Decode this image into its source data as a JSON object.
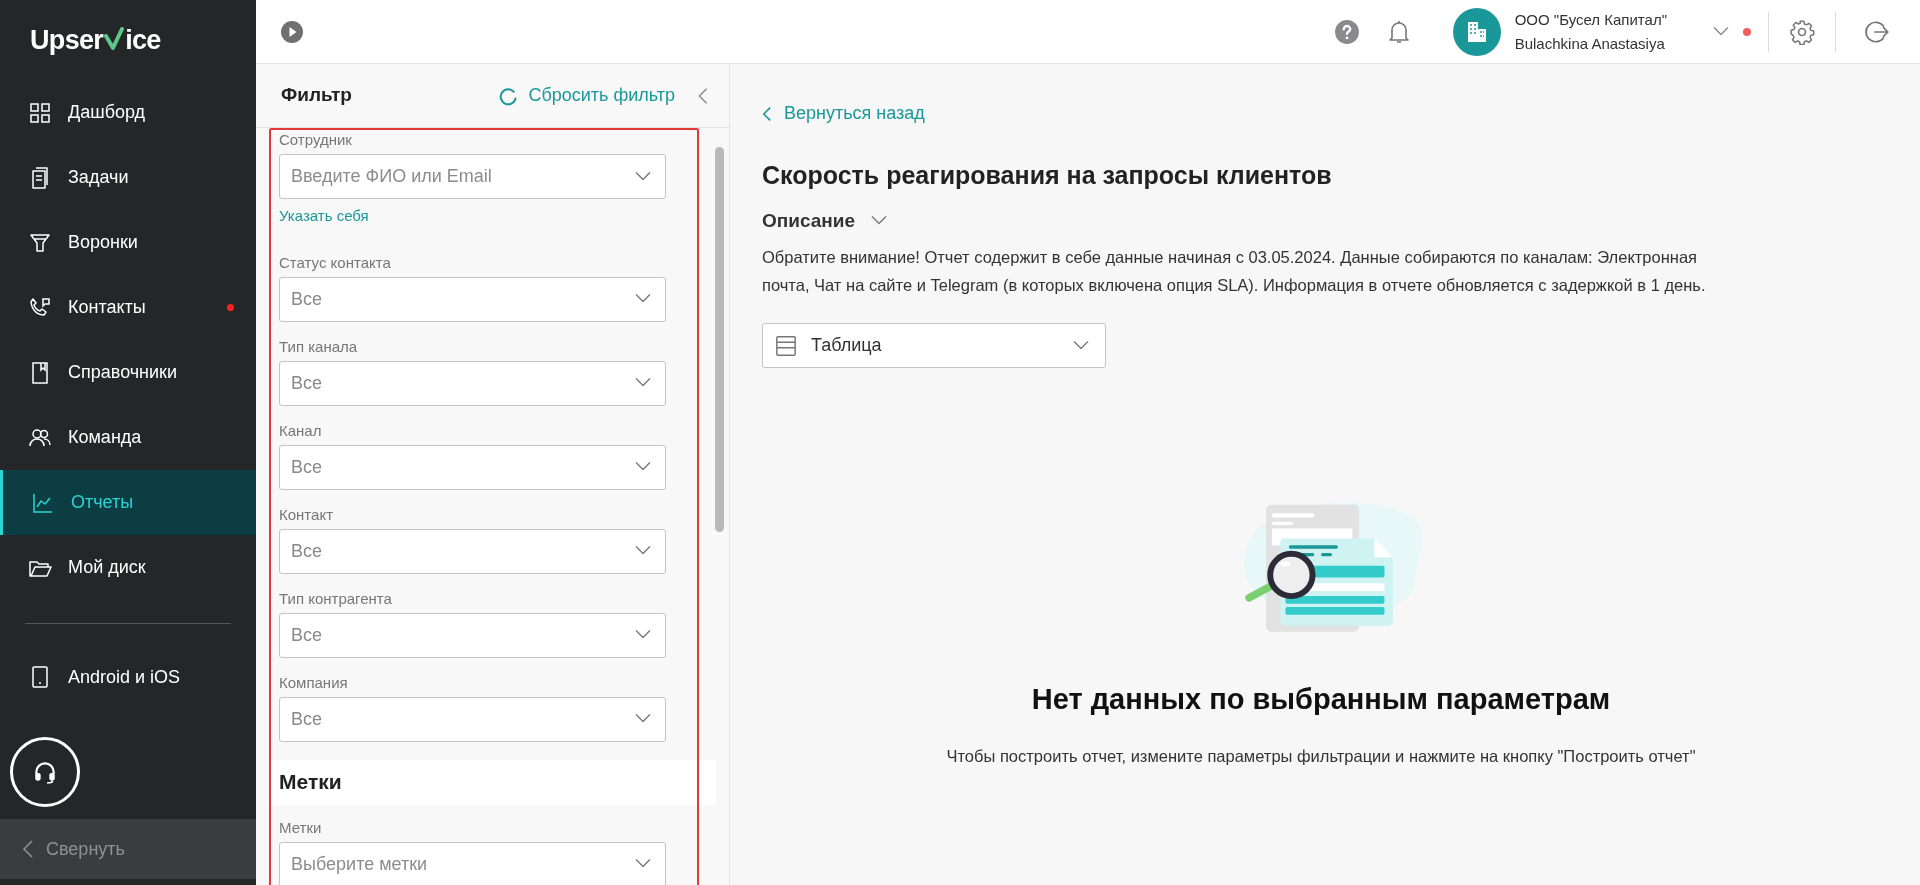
{
  "sidebar": {
    "logo": {
      "before": "Upser",
      "after": "ice"
    },
    "items": [
      {
        "label": "Дашборд",
        "selected": false,
        "dot": false
      },
      {
        "label": "Задачи",
        "selected": false,
        "dot": false
      },
      {
        "label": "Воронки",
        "selected": false,
        "dot": false
      },
      {
        "label": "Контакты",
        "selected": false,
        "dot": true
      },
      {
        "label": "Справочники",
        "selected": false,
        "dot": false
      },
      {
        "label": "Команда",
        "selected": false,
        "dot": false
      },
      {
        "label": "Отчеты",
        "selected": true,
        "dot": false
      },
      {
        "label": "Мой диск",
        "selected": false,
        "dot": false
      }
    ],
    "apps_item": "Android и iOS",
    "collapse": "Свернуть"
  },
  "top_bar": {
    "company": "ООО \"Бусел Капитал\"",
    "user": "Bulachkina Anastasiya",
    "notification_dot": true
  },
  "filter": {
    "title": "Фильтр",
    "reset": "Сбросить фильтр",
    "groups": [
      {
        "fields": [
          {
            "label": "Сотрудник",
            "placeholder": "Введите ФИО или Email",
            "link": "Указать себя"
          },
          {
            "label": "Статус контакта",
            "value": "Все"
          },
          {
            "label": "Тип канала",
            "value": "Все"
          },
          {
            "label": "Канал",
            "value": "Все"
          },
          {
            "label": "Контакт",
            "value": "Все"
          },
          {
            "label": "Тип контрагента",
            "value": "Все"
          },
          {
            "label": "Компания",
            "value": "Все"
          }
        ]
      },
      {
        "title": "Метки",
        "fields": [
          {
            "label": "Метки",
            "placeholder": "Выберите метки"
          }
        ]
      }
    ]
  },
  "report": {
    "back": "Вернуться назад",
    "title": "Скорость реагирования на запросы клиентов",
    "description": {
      "label": "Описание",
      "expanded": true,
      "text": "Обратите внимание! Отчет содержит в себе данные начиная с 03.05.2024. Данные собираются по каналам: Электронная почта, Чат на сайте и Telegram (в которых включена опция SLA). Информация в отчете обновляется с задержкой в 1 день."
    },
    "view": "Таблица",
    "empty": {
      "title": "Нет данных по выбранным параметрам",
      "text": "Чтобы построить отчет, измените параметры фильтрации и нажмите на кнопку \"Построить отчет\""
    }
  }
}
